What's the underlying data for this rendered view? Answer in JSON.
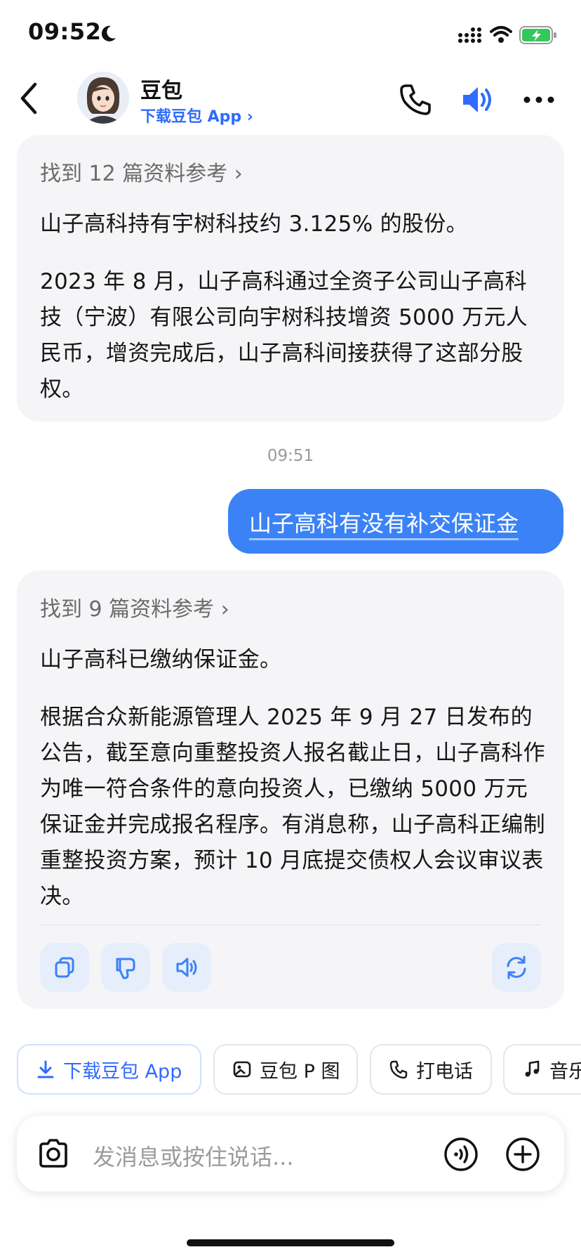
{
  "status_bar": {
    "time": "09:52"
  },
  "header": {
    "bot_name": "豆包",
    "download_link": "下载豆包 App ›"
  },
  "messages": {
    "ai1": {
      "refs": "找到 12 篇资料参考  ›",
      "para1": "山子高科持有宇树科技约 3.125% 的股份。",
      "para2": "2023 年 8 月，山子高科通过全资子公司山子高科技（宁波）有限公司向宇树科技增资 5000 万元人民币，增资完成后，山子高科间接获得了这部分股权。"
    },
    "timestamp": "09:51",
    "user": {
      "text": "山子高科有没有补交保证金"
    },
    "ai2": {
      "refs": "找到 9 篇资料参考  ›",
      "para1": "山子高科已缴纳保证金。",
      "para2": "根据合众新能源管理人 2025 年 9 月 27 日发布的公告，截至意向重整投资人报名截止日，山子高科作为唯一符合条件的意向投资人，已缴纳 5000 万元保证金并完成报名程序。有消息称，山子高科正编制重整投资方案，预计 10 月底提交债权人会议审议表决。"
    }
  },
  "quick_actions": {
    "download": "下载豆包 App",
    "p_image": "豆包 P 图",
    "call": "打电话",
    "music": "音乐"
  },
  "input": {
    "placeholder": "发消息或按住说话..."
  },
  "colors": {
    "accent": "#3b82f6",
    "link": "#2f6bff",
    "card_bg": "#f5f5f7",
    "battery": "#34c759"
  },
  "icons": [
    "moon-icon",
    "signal-icon",
    "wifi-icon",
    "battery-charging-icon",
    "back-chevron-icon",
    "phone-icon",
    "speaker-icon",
    "more-icon",
    "copy-icon",
    "thumbs-down-icon",
    "read-aloud-icon",
    "regenerate-icon",
    "download-icon",
    "image-edit-icon",
    "music-note-icon",
    "camera-icon",
    "voice-wave-icon",
    "plus-circle-icon"
  ]
}
